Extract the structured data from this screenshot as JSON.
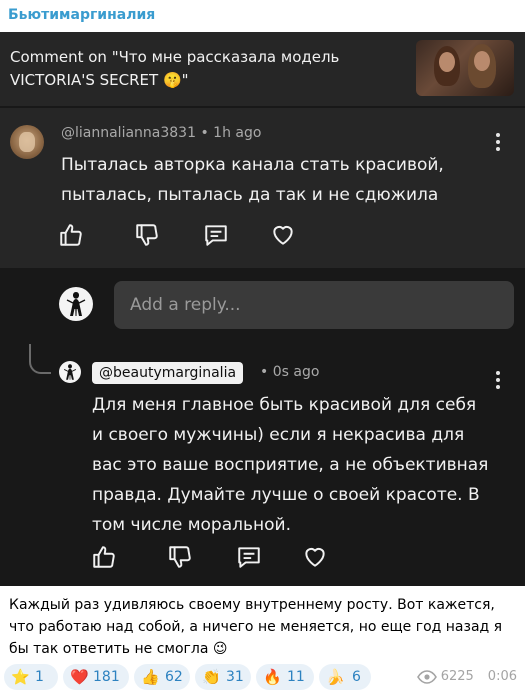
{
  "channel": {
    "name": "Бьютимаргиналия"
  },
  "header": {
    "text": "Comment on \"Что мне рассказала модель VICTORIA'S SECRET 🤫\""
  },
  "comment": {
    "author": "@liannalianna3831",
    "time": "1h ago",
    "text": "Пыталась авторка канала стать красивой, пыталась, пыталась да так и не сдюжила"
  },
  "reply_box": {
    "placeholder": "Add a reply..."
  },
  "reply": {
    "author": "@beautymarginalia",
    "time": "0s ago",
    "text": "Для меня главное быть красивой для себя и своего мужчины) если я некрасива для вас это ваше восприятие, а не объективная правда. Думайте лучше о своей красоте. В том числе моральной."
  },
  "caption": "Каждый раз удивляюсь своему внутреннему росту. Вот кажется, что работаю над собой, а ничего не меняется, но еще год назад я бы так ответить не смогла 😉",
  "reactions": [
    {
      "emoji": "⭐",
      "count": "1"
    },
    {
      "emoji": "❤️",
      "count": "181"
    },
    {
      "emoji": "👍",
      "count": "62"
    },
    {
      "emoji": "👏",
      "count": "31"
    },
    {
      "emoji": "🔥",
      "count": "11"
    },
    {
      "emoji": "🍌",
      "count": "6"
    }
  ],
  "stats": {
    "views": "6225",
    "time": "0:06"
  },
  "colors": {
    "accent": "#3a9ccf",
    "reaction_text": "#2d82c0",
    "reaction_bg": "#e9f1f8",
    "panel_bg": "#181818",
    "card_bg": "#262626"
  }
}
